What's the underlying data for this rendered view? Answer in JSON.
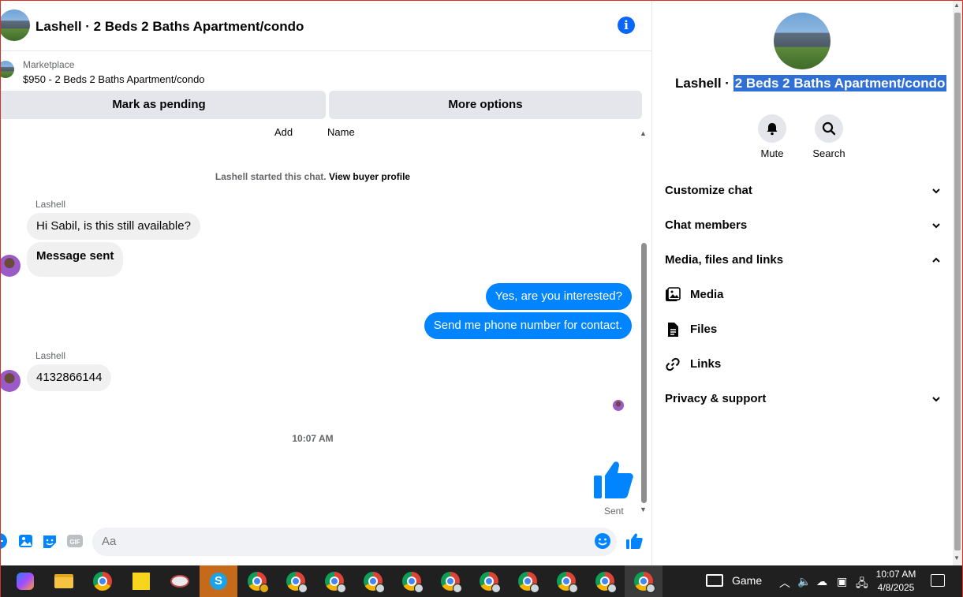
{
  "header": {
    "title": "Lashell · 2 Beds 2 Baths Apartment/condo",
    "info_icon": "info-icon",
    "info_glyph": "i"
  },
  "listing": {
    "source": "Marketplace",
    "summary": "$950 - 2 Beds 2 Baths Apartment/condo"
  },
  "actions": {
    "mark_pending": "Mark as pending",
    "more_options": "More options"
  },
  "conversation": {
    "cut_off_labels": [
      "Add",
      "Name"
    ],
    "system_text": "Lashell started this chat.",
    "system_link": "View buyer profile",
    "messages": [
      {
        "sender": "Lashell",
        "text": "Hi Sabil, is this still available?"
      },
      {
        "text": "Message sent"
      },
      {
        "text": "Yes, are you interested?"
      },
      {
        "text": "Send me phone number for contact."
      },
      {
        "sender": "Lashell",
        "text": "4132866144"
      }
    ],
    "time_separator": "10:07 AM",
    "status": "Sent"
  },
  "composer": {
    "placeholder": "Aa",
    "icons": [
      "plus-icon",
      "photo-icon",
      "sticker-icon",
      "gif-icon",
      "emoji-icon",
      "like-icon"
    ],
    "gif_label": "GIF"
  },
  "side_panel": {
    "name_prefix": "Lashell ·",
    "name_selected": "2 Beds 2 Baths Apartment/condo",
    "actions": [
      {
        "label": "Mute",
        "icon": "bell-icon"
      },
      {
        "label": "Search",
        "icon": "search-icon"
      }
    ],
    "sections": [
      {
        "label": "Customize chat",
        "expanded": false
      },
      {
        "label": "Chat members",
        "expanded": false
      },
      {
        "label": "Media, files and links",
        "expanded": true
      },
      {
        "label": "Privacy & support",
        "expanded": false
      }
    ],
    "media_items": [
      {
        "label": "Media",
        "icon": "media-icon"
      },
      {
        "label": "Files",
        "icon": "file-icon"
      },
      {
        "label": "Links",
        "icon": "link-icon"
      }
    ]
  },
  "taskbar": {
    "game_label": "Game",
    "time": "10:07 AM",
    "date": "4/8/2025",
    "colors": {
      "background": "#202020",
      "messenger_blue": "#0084ff",
      "accent": "#0866ff",
      "selection": "#2f6fd6"
    }
  }
}
